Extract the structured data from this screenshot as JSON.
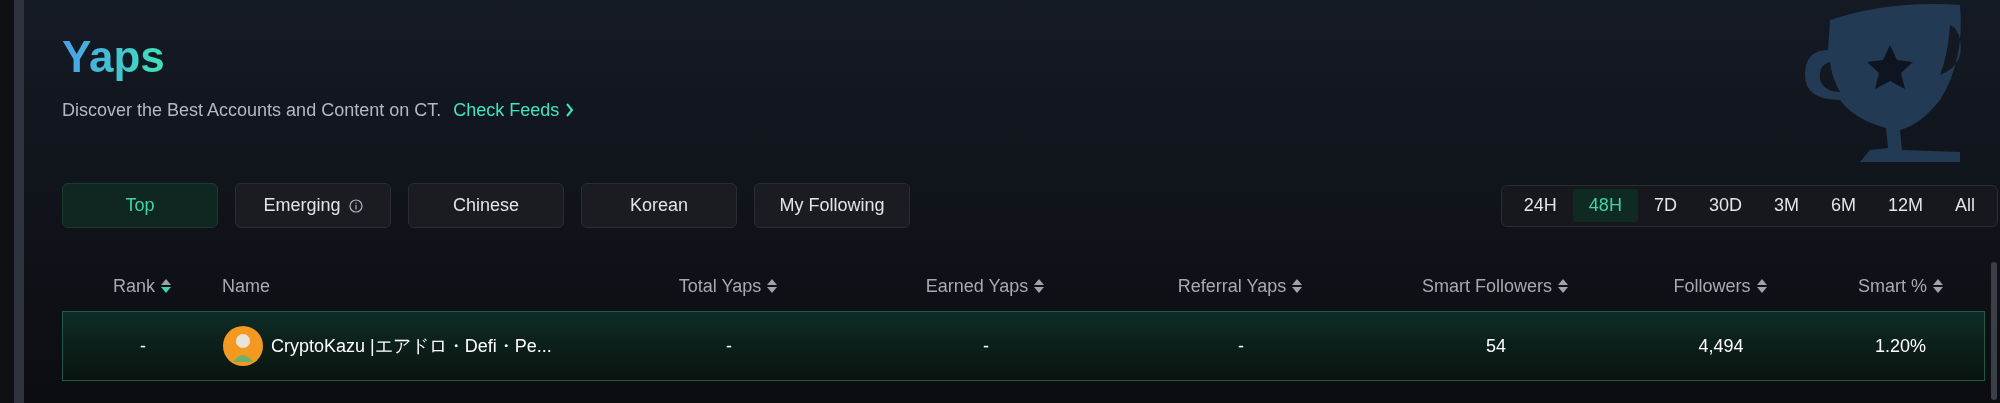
{
  "header": {
    "title": "Yaps",
    "subtitle": "Discover the Best Accounts and Content on CT.",
    "link": "Check Feeds"
  },
  "categories": [
    {
      "label": "Top",
      "selected": true,
      "info": false
    },
    {
      "label": "Emerging",
      "selected": false,
      "info": true
    },
    {
      "label": "Chinese",
      "selected": false,
      "info": false
    },
    {
      "label": "Korean",
      "selected": false,
      "info": false
    },
    {
      "label": "My Following",
      "selected": false,
      "info": false
    }
  ],
  "time_ranges": [
    {
      "label": "24H",
      "selected": false
    },
    {
      "label": "48H",
      "selected": true
    },
    {
      "label": "7D",
      "selected": false
    },
    {
      "label": "30D",
      "selected": false
    },
    {
      "label": "3M",
      "selected": false
    },
    {
      "label": "6M",
      "selected": false
    },
    {
      "label": "12M",
      "selected": false
    },
    {
      "label": "All",
      "selected": false
    }
  ],
  "table": {
    "columns": [
      {
        "label": "Rank",
        "sorted": true
      },
      {
        "label": "Name"
      },
      {
        "label": "Total Yaps",
        "sorted": false
      },
      {
        "label": "Earned Yaps",
        "sorted": false
      },
      {
        "label": "Referral Yaps",
        "sorted": false
      },
      {
        "label": "Smart Followers",
        "sorted": false
      },
      {
        "label": "Followers",
        "sorted": false
      },
      {
        "label": "Smart %",
        "sorted": false
      }
    ],
    "rows": [
      {
        "highlighted": true,
        "cells": [
          "-",
          "CryptoKazu |エアドロ・Defi・Pe...",
          "-",
          "-",
          "-",
          "54",
          "4,494",
          "1.20%"
        ]
      }
    ]
  }
}
